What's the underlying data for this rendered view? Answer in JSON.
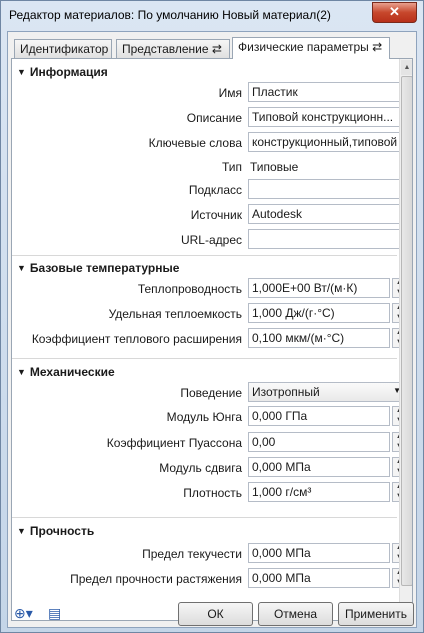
{
  "window": {
    "title": "Редактор материалов: По умолчанию Новый материал(2)",
    "close_label": "✕"
  },
  "tabs": [
    {
      "label": "Идентификатор"
    },
    {
      "label": "Представление ⇄"
    },
    {
      "label": "Физические параметры ⇄"
    }
  ],
  "sections": {
    "info": {
      "title": "Информация",
      "name_label": "Имя",
      "name_value": "Пластик",
      "desc_label": "Описание",
      "desc_value": "Типовой конструкционн...",
      "keywords_label": "Ключевые слова",
      "keywords_value": "конструкционный,типовой",
      "type_label": "Тип",
      "type_value": "Типовые",
      "subclass_label": "Подкласс",
      "subclass_value": "",
      "source_label": "Источник",
      "source_value": "Autodesk",
      "url_label": "URL-адрес",
      "url_value": ""
    },
    "thermal": {
      "title": "Базовые температурные",
      "cond_label": "Теплопроводность",
      "cond_value": "1,000E+00 Вт/(м·К)",
      "heat_label": "Удельная теплоемкость",
      "heat_value": "1,000 Дж/(г·°С)",
      "exp_label": "Коэффициент теплового расширения",
      "exp_value": "0,100 мкм/(м·°С)"
    },
    "mech": {
      "title": "Механические",
      "behavior_label": "Поведение",
      "behavior_value": "Изотропный",
      "young_label": "Модуль Юнга",
      "young_value": "0,000 ГПа",
      "poisson_label": "Коэффициент Пуассона",
      "poisson_value": "0,00",
      "shear_label": "Модуль сдвига",
      "shear_value": "0,000 МПа",
      "density_label": "Плотность",
      "density_value": "1,000 г/см³"
    },
    "strength": {
      "title": "Прочность",
      "yield_label": "Предел текучести",
      "yield_value": "0,000 МПа",
      "tensile_label": "Предел прочности растяжения",
      "tensile_value": "0,000 МПа"
    }
  },
  "footer": {
    "ok_label": "ОК",
    "cancel_label": "Отмена",
    "apply_label": "Применить"
  }
}
